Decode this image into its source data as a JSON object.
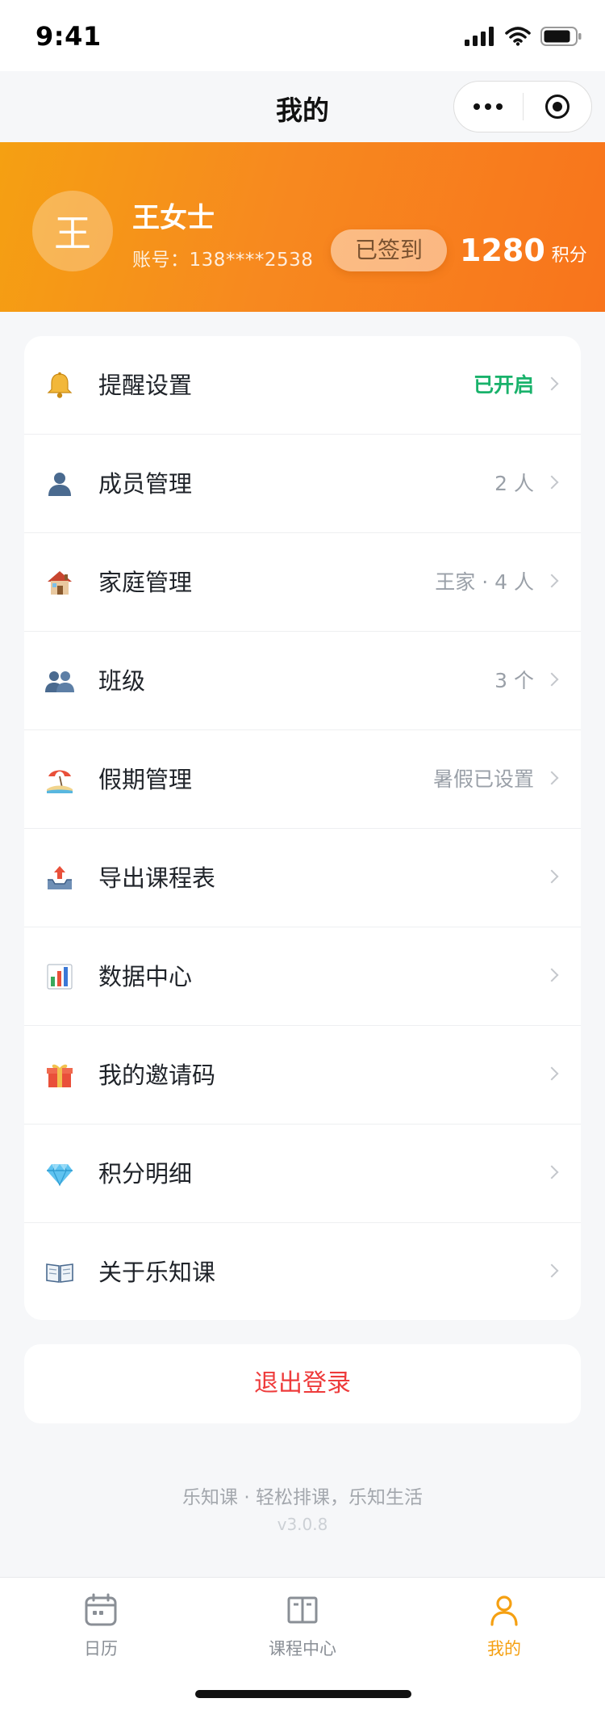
{
  "status_bar": {
    "time": "9:41"
  },
  "nav": {
    "title": "我的"
  },
  "profile": {
    "avatar_char": "王",
    "name": "王女士",
    "account": "账号：138****2538",
    "sign_label": "已签到",
    "points_value": "1280",
    "points_unit": "积分"
  },
  "menu": [
    {
      "label": "提醒设置",
      "value": "已开启",
      "icon": "bell-icon"
    },
    {
      "label": "成员管理",
      "value": "2 人",
      "icon": "person-icon"
    },
    {
      "label": "家庭管理",
      "value": "王家 · 4 人",
      "icon": "house-icon"
    },
    {
      "label": "班级",
      "value": "3 个",
      "icon": "group-icon"
    },
    {
      "label": "假期管理",
      "value": "暑假已设置",
      "icon": "beach-icon"
    },
    {
      "label": "导出课程表",
      "value": "",
      "icon": "export-tray-icon"
    },
    {
      "label": "数据中心",
      "value": "",
      "icon": "bar-chart-icon"
    },
    {
      "label": "我的邀请码",
      "value": "",
      "icon": "gift-icon"
    },
    {
      "label": "积分明细",
      "value": "",
      "icon": "diamond-icon"
    },
    {
      "label": "关于乐知课",
      "value": "",
      "icon": "book-icon"
    }
  ],
  "colors": {
    "accent": "#f5a012",
    "enabled": "#19b26b",
    "danger": "#ee3b3b"
  },
  "logout_label": "退出登录",
  "footer": {
    "slogan": "乐知课 · 轻松排课，乐知生活",
    "version": "v3.0.8"
  },
  "tabs": [
    {
      "label": "日历",
      "icon": "calendar-icon",
      "active": false
    },
    {
      "label": "课程中心",
      "icon": "book-columns-icon",
      "active": false
    },
    {
      "label": "我的",
      "icon": "user-icon",
      "active": true
    }
  ]
}
